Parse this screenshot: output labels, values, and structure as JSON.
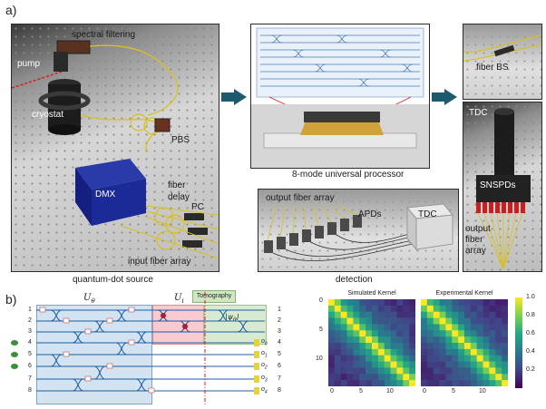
{
  "panel_a": {
    "label": "a)",
    "source": {
      "caption": "quantum-dot source",
      "labels": {
        "spectral_filtering": "spectral filtering",
        "pump": "pump",
        "cryostat": "cryostat",
        "pbs": "PBS",
        "dmx": "DMX",
        "fiber": "fiber",
        "delay": "delay",
        "pc": "PC",
        "input_fiber_array": "input fiber array"
      }
    },
    "processor": {
      "caption": "8-mode universal processor"
    },
    "detection": {
      "caption": "detection",
      "labels": {
        "output_fiber_array": "output fiber array",
        "apds": "APDs",
        "tdc": "TDC"
      }
    },
    "right_column": {
      "labels": {
        "fiber_bs": "fiber BS",
        "tdc": "TDC",
        "snspds": "SNSPDs",
        "output": "output",
        "fiber": "fiber",
        "array": "array"
      }
    }
  },
  "panel_b": {
    "label": "b)",
    "u0_label": "U",
    "u0_sub": "θ",
    "ui_label": "U",
    "ui_sub": "i",
    "tomography": "Tomography",
    "psi_label": "|ψ",
    "psi_sub": "θ",
    "psi_close": "⟩",
    "modes_left": [
      "1",
      "2",
      "3",
      "4",
      "5",
      "6",
      "7",
      "8"
    ],
    "modes_right": [
      "1",
      "2",
      "3",
      "4",
      "5",
      "6",
      "7",
      "8"
    ],
    "ancilla": [
      "o",
      "o",
      "o",
      "o",
      "o"
    ],
    "ancilla_sub": [
      "0",
      "1",
      "2",
      "3",
      "4"
    ],
    "colors": {
      "u0": "#b0cce6",
      "ui": "#f6b4ba",
      "psi": "#c8e2be",
      "photon": "#3a8f3a",
      "waveguide": "#1d5fa3"
    }
  },
  "kernels": {
    "colorbar_ticks": [
      "1.0",
      "0.8",
      "0.6",
      "0.4",
      "0.2"
    ],
    "colormap": "viridis",
    "simulated": {
      "title": "Simulated Kernel",
      "y_ticks": [
        "0",
        "5",
        "10"
      ],
      "x_ticks": [
        "0",
        "5",
        "10"
      ]
    },
    "experimental": {
      "title": "Experimental Kernel",
      "x_ticks": [
        "0",
        "5",
        "10"
      ]
    }
  }
}
